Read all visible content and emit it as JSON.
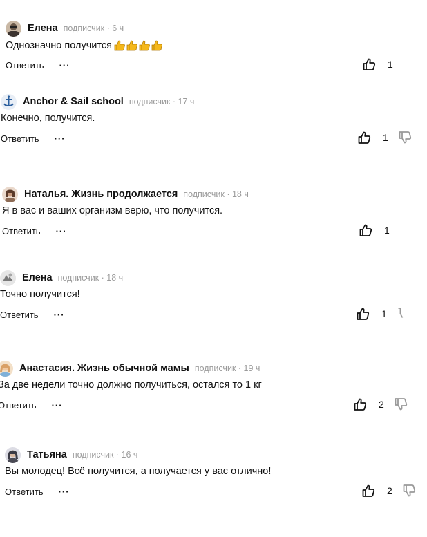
{
  "comments": [
    {
      "author": "Елена",
      "meta": "подписчик · 6 ч",
      "text": "Однозначно получится",
      "emoji": "👍👍👍👍",
      "reply_label": "Ответить",
      "more_label": "···",
      "likes": "1",
      "avatar_color": "#6b5a4b"
    },
    {
      "author": "Anchor & Sail school",
      "meta": "подписчик · 17 ч",
      "text": "Конечно, получится.",
      "reply_label": "Ответить",
      "more_label": "···",
      "likes": "1",
      "avatar_color": "#2b5f9e"
    },
    {
      "author": "Наталья. Жизнь продолжается",
      "meta": "подписчик · 18 ч",
      "text": "Я в вас и ваших организм верю, что получится.",
      "reply_label": "Ответить",
      "more_label": "···",
      "likes": "1",
      "avatar_color": "#8d6b55"
    },
    {
      "author": "Елена",
      "meta": "подписчик · 18 ч",
      "text": "Точно получится!",
      "reply_label": "Ответить",
      "more_label": "···",
      "likes": "1",
      "avatar_color": "#7a7a7a"
    },
    {
      "author": "Анастасия. Жизнь обычной мамы",
      "meta": "подписчик · 19 ч",
      "text": "За две недели точно должно получиться, остался то 1 кг",
      "reply_label": "Ответить",
      "more_label": "···",
      "likes": "2",
      "avatar_color": "#d9a066"
    },
    {
      "author": "Татьяна",
      "meta": "подписчик · 16 ч",
      "text": "Вы молодец! Всё получится, а получается у вас отлично!",
      "reply_label": "Ответить",
      "more_label": "···",
      "likes": "2",
      "avatar_color": "#4a4a55"
    }
  ]
}
